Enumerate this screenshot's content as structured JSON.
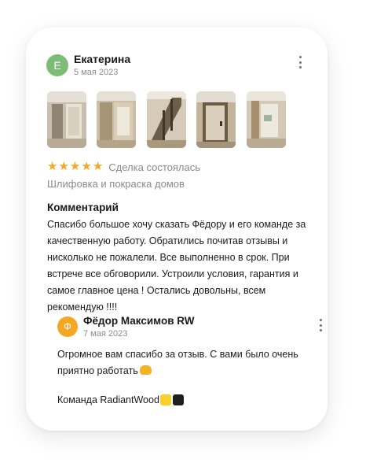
{
  "review": {
    "author_initial": "Е",
    "author_name": "Екатерина",
    "date": "5 мая 2023",
    "stars": "★★★★★",
    "deal_status": "Сделка состоялась",
    "service": "Шлифовка и покраска домов",
    "comment_title": "Комментарий",
    "comment_text": "Спасибо большое хочу сказать Фёдору и его команде за качественную работу. Обратились почитав отзывы и нисколько  не пожалели. Все выполненно в срок. При встрече все обговорили. Устроили условия, гарантия и самое главное цена ! Остались довольны, всем рекомендую !!!!",
    "rating": 5
  },
  "photos": [
    {
      "label": "photo-1"
    },
    {
      "label": "photo-2"
    },
    {
      "label": "photo-3"
    },
    {
      "label": "photo-4"
    },
    {
      "label": "photo-5"
    }
  ],
  "reply": {
    "author_initial": "Ф",
    "author_name": "Фёдор Максимов RW",
    "date": "7 мая 2023",
    "text": "Огромное вам спасибо за отзыв. С вами было очень приятно работать",
    "signature": "Команда RadiantWood"
  },
  "colors": {
    "avatar_review": "#7cbc74",
    "avatar_reply": "#f5a623",
    "star": "#f5a623",
    "muted_text": "#8a8a8a"
  }
}
